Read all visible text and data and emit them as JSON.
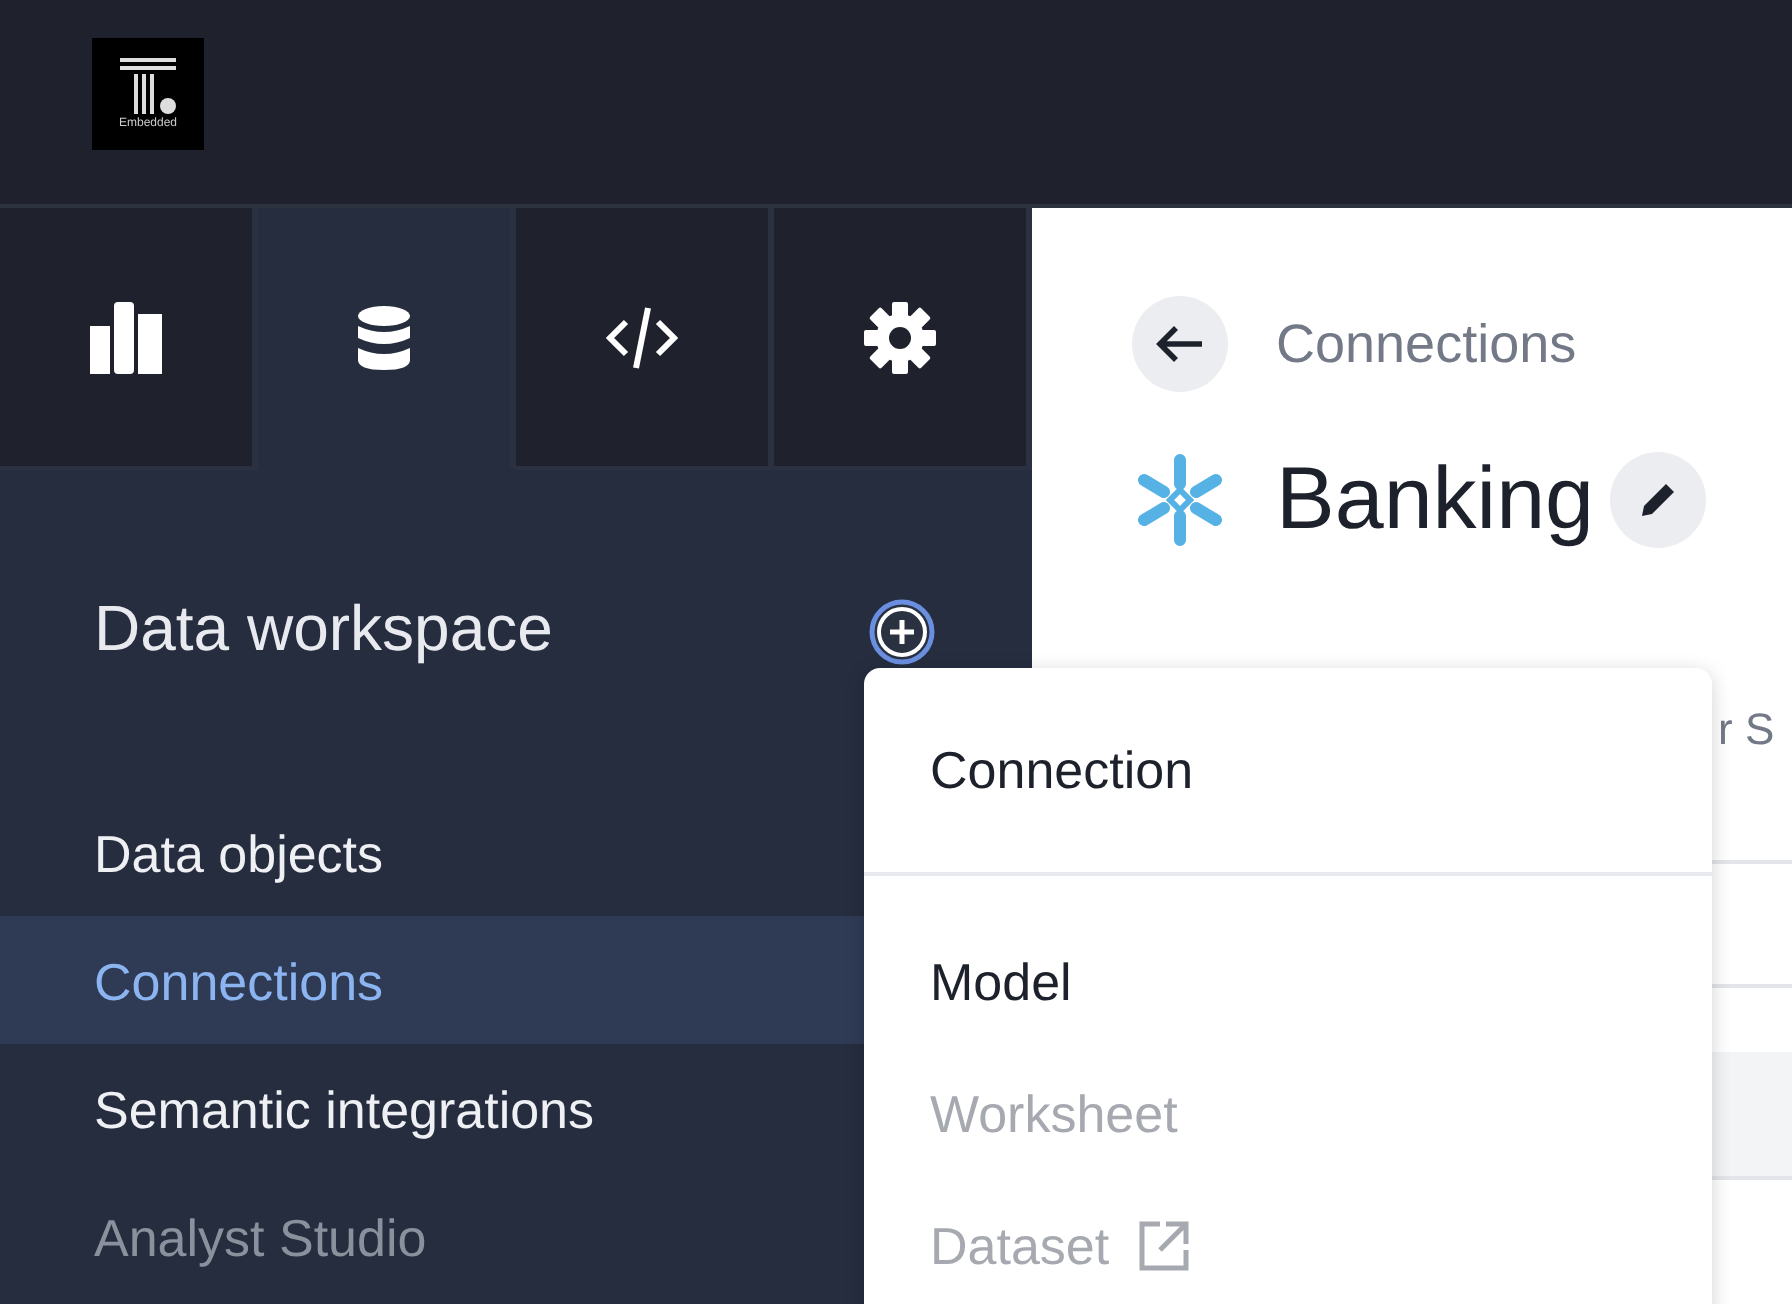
{
  "header": {
    "logo_caption": "Embedded"
  },
  "nav_tabs": [
    {
      "kind": "chart",
      "selected": false
    },
    {
      "kind": "database",
      "selected": true
    },
    {
      "kind": "code",
      "selected": false
    },
    {
      "kind": "settings",
      "selected": false
    }
  ],
  "sidebar": {
    "title": "Data workspace",
    "items": [
      {
        "label": "Data objects",
        "selected": false,
        "disabled": false
      },
      {
        "label": "Connections",
        "selected": true,
        "disabled": false
      },
      {
        "label": "Semantic integrations",
        "selected": false,
        "disabled": false
      },
      {
        "label": "Analyst Studio",
        "selected": false,
        "disabled": true
      }
    ]
  },
  "page": {
    "breadcrumb": "Connections",
    "title": "Banking",
    "hidden_text": "r S"
  },
  "add_menu": {
    "items": [
      {
        "label": "Connection",
        "disabled": false,
        "external": false,
        "divider_after": true
      },
      {
        "label": "Model",
        "disabled": false,
        "external": false,
        "divider_after": false
      },
      {
        "label": "Worksheet",
        "disabled": true,
        "external": false,
        "divider_after": false
      },
      {
        "label": "Dataset",
        "disabled": true,
        "external": true,
        "divider_after": false
      }
    ]
  }
}
